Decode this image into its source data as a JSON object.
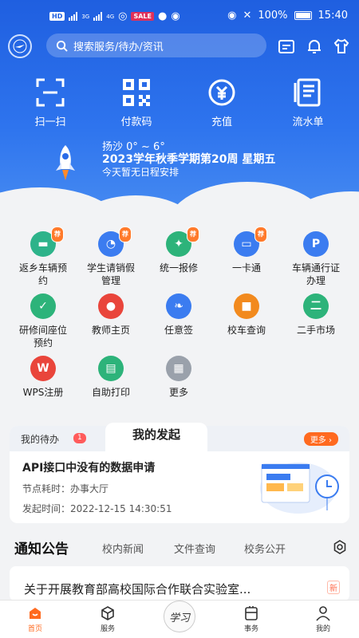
{
  "status_bar": {
    "time": "15:40",
    "battery": "100%",
    "sim_badge": "HD",
    "net1": "3G",
    "net2": "4G",
    "app_badge": "SALE"
  },
  "header": {
    "search_placeholder": "搜索服务/待办/资讯"
  },
  "quick_actions": [
    {
      "label": "扫一扫",
      "icon": "scan-icon"
    },
    {
      "label": "付款码",
      "icon": "qrcode-icon"
    },
    {
      "label": "充值",
      "icon": "recharge-icon"
    },
    {
      "label": "流水单",
      "icon": "statement-icon"
    }
  ],
  "weather": {
    "line": "扬沙 0° ~ 6°",
    "week": "2023学年秋季学期第20周 星期五",
    "schedule": "今天暂无日程安排"
  },
  "services": [
    {
      "label": "返乡车辆预约",
      "badge": "荐",
      "color": "#2db38a",
      "icon": "bus-icon"
    },
    {
      "label": "学生请销假管理",
      "badge": "荐",
      "color": "#3b7cf0",
      "icon": "user-clock-icon"
    },
    {
      "label": "统一报修",
      "badge": "荐",
      "color": "#2db37a",
      "icon": "wrench-icon"
    },
    {
      "label": "一卡通",
      "badge": "荐",
      "color": "#3b7cf0",
      "icon": "card-icon"
    },
    {
      "label": "车辆通行证办理",
      "badge": "",
      "color": "#3b7cf0",
      "icon": "parking-icon"
    },
    {
      "label": "研修间座位预约",
      "badge": "",
      "color": "#2db37a",
      "icon": "seat-check-icon"
    },
    {
      "label": "教师主页",
      "badge": "",
      "color": "#e9453b",
      "icon": "teacher-icon"
    },
    {
      "label": "任意签",
      "badge": "",
      "color": "#3b7cf0",
      "icon": "feather-icon"
    },
    {
      "label": "校车查询",
      "badge": "",
      "color": "#f28a1e",
      "icon": "schoolbus-icon"
    },
    {
      "label": "二手市场",
      "badge": "",
      "color": "#2db37a",
      "icon": "secondhand-icon"
    },
    {
      "label": "WPS注册",
      "badge": "",
      "color": "#e9453b",
      "icon": "wps-icon"
    },
    {
      "label": "自助打印",
      "badge": "",
      "color": "#2db37a",
      "icon": "printer-icon"
    },
    {
      "label": "更多",
      "badge": "",
      "color": "#9aa1ab",
      "icon": "more-grid-icon"
    }
  ],
  "todo_card": {
    "tab_todo": "我的待办",
    "todo_count": "1",
    "tab_initiated": "我的发起",
    "more": "更多",
    "title": "API接口中没有的数据申请",
    "node_label": "节点耗时：",
    "node_value": "办事大厅",
    "time_label": "发起时间：",
    "time_value": "2022-12-15 14:30:51"
  },
  "notices": {
    "tabs": [
      "通知公告",
      "校内新闻",
      "文件查询",
      "校务公开"
    ],
    "item_title": "关于开展教育部高校国际合作联合实验室...",
    "item_badge": "新"
  },
  "bottom_nav": [
    {
      "label": "首页",
      "active": true
    },
    {
      "label": "服务",
      "active": false
    },
    {
      "label": "学习",
      "active": false
    },
    {
      "label": "事务",
      "active": false
    },
    {
      "label": "我的",
      "active": false
    }
  ],
  "colors": {
    "primary": "#1f5fe0",
    "accent": "#ff6a1f"
  }
}
